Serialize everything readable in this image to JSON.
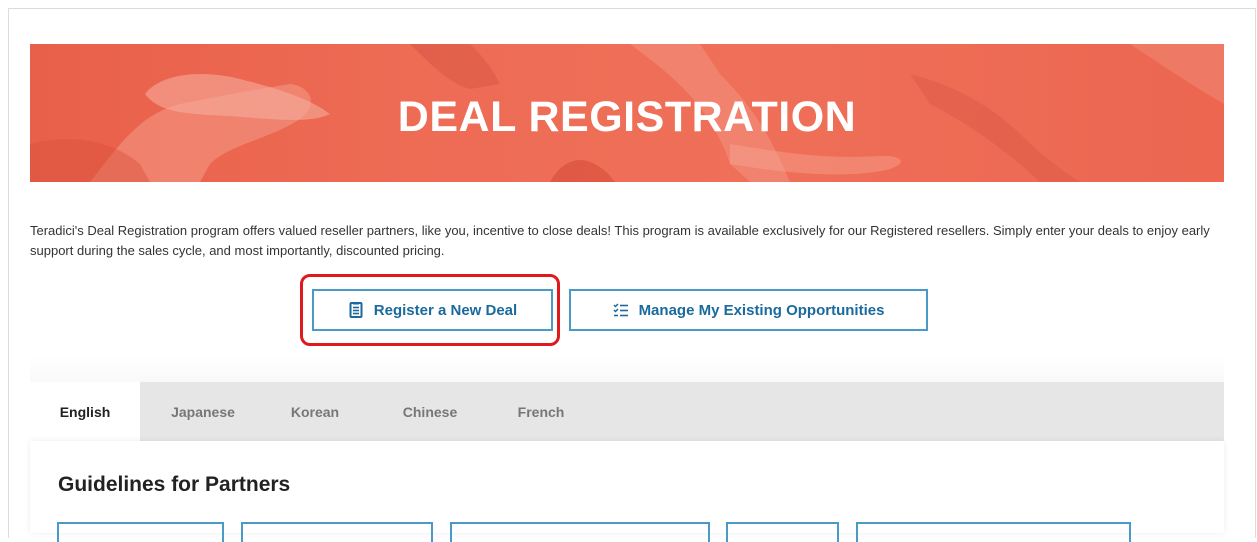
{
  "hero": {
    "title": "DEAL REGISTRATION"
  },
  "intro": {
    "text": "Teradici's Deal Registration program offers valued reseller partners, like you, incentive to close deals! This program is available exclusively for our Registered resellers. Simply enter your deals to enjoy early support during the sales cycle, and most importantly, discounted pricing."
  },
  "actions": {
    "register_label": "Register a New Deal",
    "manage_label": "Manage My Existing Opportunities",
    "register_icon": "document-icon",
    "manage_icon": "checklist-icon"
  },
  "tabs": [
    {
      "label": "English",
      "active": true
    },
    {
      "label": "Japanese",
      "active": false
    },
    {
      "label": "Korean",
      "active": false
    },
    {
      "label": "Chinese",
      "active": false
    },
    {
      "label": "French",
      "active": false
    }
  ],
  "guidelines": {
    "title": "Guidelines for Partners"
  },
  "colors": {
    "hero": "#ee6c55",
    "button_border": "#4a9ac8",
    "button_text": "#1a6a9e",
    "highlight": "#e0191e",
    "tab_bar": "#e6e6e6"
  }
}
